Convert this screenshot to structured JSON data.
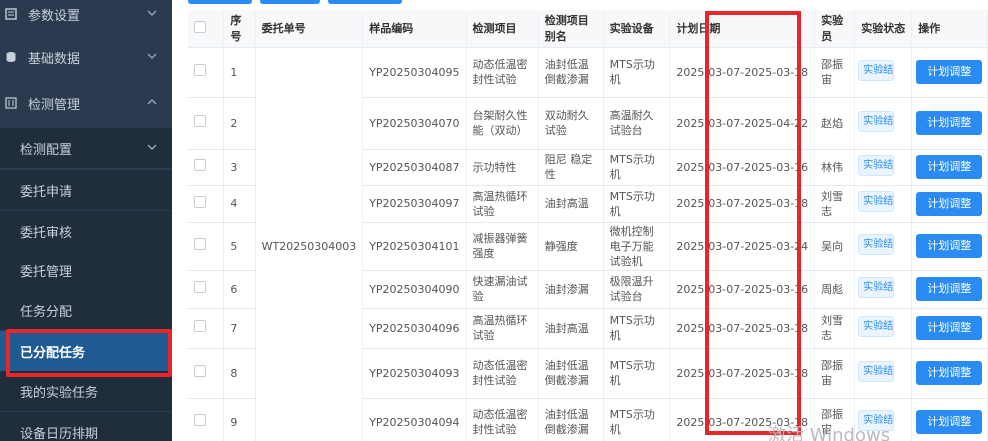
{
  "sidebar": {
    "menus": [
      {
        "label": "参数设置",
        "icon": "settings-icon"
      },
      {
        "label": "基础数据",
        "icon": "database-icon"
      },
      {
        "label": "检测管理",
        "icon": "flask-icon"
      }
    ],
    "submenus": [
      {
        "label": "检测配置"
      },
      {
        "label": "委托申请"
      },
      {
        "label": "委托审核"
      },
      {
        "label": "委托管理"
      },
      {
        "label": "任务分配"
      },
      {
        "label": "已分配任务"
      },
      {
        "label": "我的实验任务"
      },
      {
        "label": "设备日历排期"
      }
    ],
    "active_item": "已分配任务"
  },
  "table": {
    "headers": [
      "序号",
      "委托单号",
      "样品编码",
      "检测项目",
      "检测项目别名",
      "实验设备",
      "计划日期",
      "实验员",
      "实验状态",
      "操作"
    ],
    "commission_no": "WT20250304003",
    "rows": [
      {
        "no": "1",
        "sample": "YP20250304095",
        "item": "动态低温密封性试验",
        "alias": "油封低温倒截渗漏",
        "device": "MTS示功机",
        "date": "2025-03-07-2025-03-18",
        "tester": "邵振宙",
        "status": "实验结",
        "action": "计划调整"
      },
      {
        "no": "2",
        "sample": "YP20250304070",
        "item": "台架耐久性能（双动）",
        "alias": "双动耐久试验",
        "device": "高温耐久试验台",
        "date": "2025-03-07-2025-04-22",
        "tester": "赵焰",
        "status": "实验结",
        "action": "计划调整"
      },
      {
        "no": "3",
        "sample": "YP20250304087",
        "item": "示功特性",
        "alias": "阻尼 稳定性",
        "device": "MTS示功机",
        "date": "2025-03-07-2025-03-16",
        "tester": "林伟",
        "status": "实验结",
        "action": "计划调整"
      },
      {
        "no": "4",
        "sample": "YP20250304097",
        "item": "高温热循环试验",
        "alias": "油封高温",
        "device": "MTS示功机",
        "date": "2025-03-07-2025-03-18",
        "tester": "刘雪志",
        "status": "实验结",
        "action": "计划调整"
      },
      {
        "no": "5",
        "sample": "YP20250304101",
        "item": "减振器弹簧强度",
        "alias": "静强度",
        "device": "微机控制电子万能试验机",
        "date": "2025-03-07-2025-03-24",
        "tester": "吴向",
        "status": "实验结",
        "action": "计划调整"
      },
      {
        "no": "6",
        "sample": "YP20250304090",
        "item": "快速漏油试验",
        "alias": "油封渗漏",
        "device": "极限温升试验台",
        "date": "2025-03-07-2025-03-16",
        "tester": "周彪",
        "status": "实验结",
        "action": "计划调整"
      },
      {
        "no": "7",
        "sample": "YP20250304096",
        "item": "高温热循环试验",
        "alias": "油封高温",
        "device": "MTS示功机",
        "date": "2025-03-07-2025-03-18",
        "tester": "刘雪志",
        "status": "实验结",
        "action": "计划调整"
      },
      {
        "no": "8",
        "sample": "YP20250304093",
        "item": "动态低温密封性试验",
        "alias": "油封低温倒截渗漏",
        "device": "MTS示功机",
        "date": "2025-03-07-2025-03-18",
        "tester": "邵振宙",
        "status": "实验结",
        "action": "计划调整"
      },
      {
        "no": "9",
        "sample": "YP20250304094",
        "item": "动态低温密封性试验",
        "alias": "油封低温倒截渗漏",
        "device": "MTS示功机",
        "date": "2025-03-07-2025-03-18",
        "tester": "邵振宙",
        "status": "实验结",
        "action": "计划调整"
      }
    ]
  },
  "watermark": "激活 Windows",
  "colors": {
    "sidebar_bg": "#2b3a4e",
    "submenu_bg": "#1f2d3d",
    "active_bg": "#1f5a92",
    "primary": "#2a8bf2",
    "highlight": "#e8262a"
  }
}
